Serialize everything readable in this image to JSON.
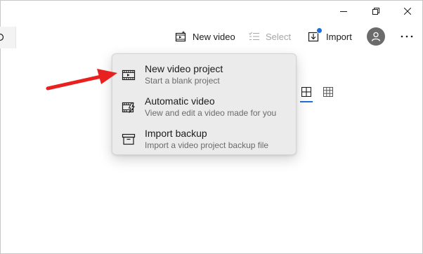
{
  "titlebar": {
    "minimize_icon": "minimize-icon",
    "maximize_icon": "restore-icon",
    "close_icon": "close-icon"
  },
  "toolbar": {
    "new_video_label": "New video",
    "select_label": "Select",
    "import_label": "Import",
    "accent_color": "#1d6fe0",
    "disabled_color": "#a6a6a6"
  },
  "menu": {
    "items": [
      {
        "title": "New video project",
        "subtitle": "Start a blank project",
        "icon": "video-project-icon"
      },
      {
        "title": "Automatic video",
        "subtitle": "View and edit a video made for you",
        "icon": "automatic-video-icon"
      },
      {
        "title": "Import backup",
        "subtitle": "Import a video project backup file",
        "icon": "archive-box-icon"
      }
    ]
  },
  "annotation": {
    "arrow_color": "#e8201f"
  }
}
